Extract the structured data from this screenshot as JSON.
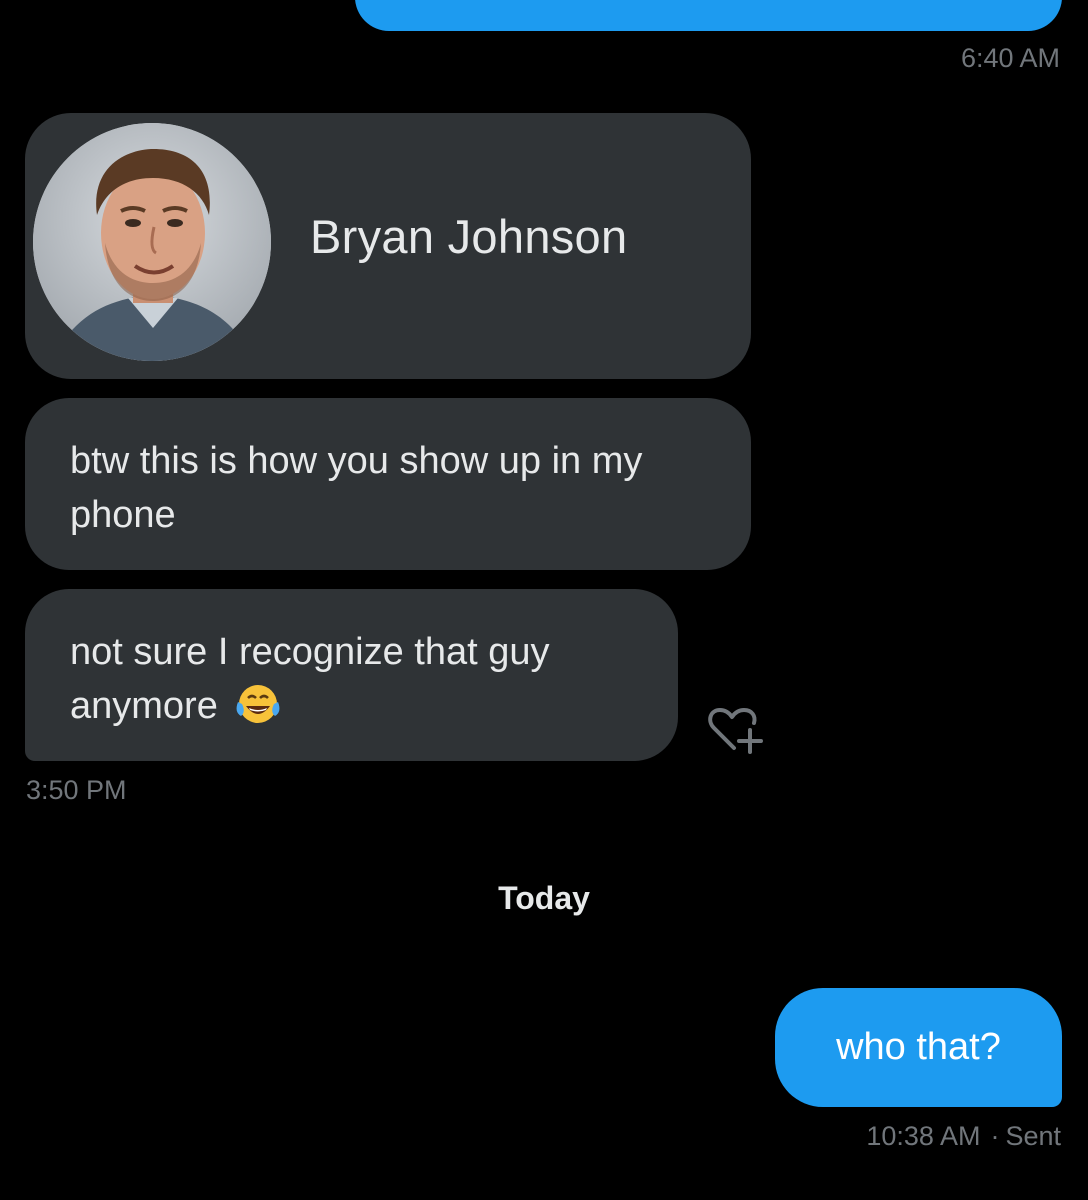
{
  "thread": {
    "top_time": "6:40 AM",
    "contact_card": {
      "name": "Bryan Johnson",
      "avatar_icon": "contact-avatar-photo"
    },
    "incoming": [
      {
        "text": "btw this is how you show up in my phone"
      },
      {
        "text": "not sure I recognize that guy anymore",
        "emoji": "face-with-tears-of-joy"
      }
    ],
    "incoming_time": "3:50 PM",
    "react_icon": "heart-plus-icon",
    "date_separator": "Today",
    "outgoing": {
      "text": "who that?",
      "time": "10:38 AM",
      "separator": "·",
      "status": "Sent"
    }
  },
  "colors": {
    "background": "#000000",
    "incoming_bubble": "#2f3336",
    "outgoing_bubble": "#1d9bf0",
    "muted_text": "#71767b"
  }
}
